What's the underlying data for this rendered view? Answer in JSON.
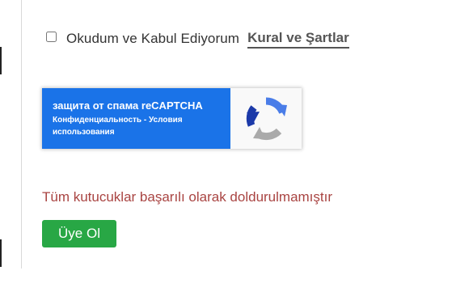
{
  "terms": {
    "checkbox_label": "Okudum ve Kabul Ediyorum",
    "link_label": "Kural ve Şartlar",
    "checked": false
  },
  "recaptcha": {
    "title": "защита от спама reCAPTCHA",
    "links": "Конфиденциальность - Условия использования",
    "icon": "recaptcha-logo-icon",
    "panel_color": "#1a73e8"
  },
  "form": {
    "error_message": "Tüm kutucuklar başarılı olarak doldurulmamıştır",
    "error_color": "#a94442",
    "submit_label": "Üye Ol",
    "submit_color": "#28a745"
  }
}
